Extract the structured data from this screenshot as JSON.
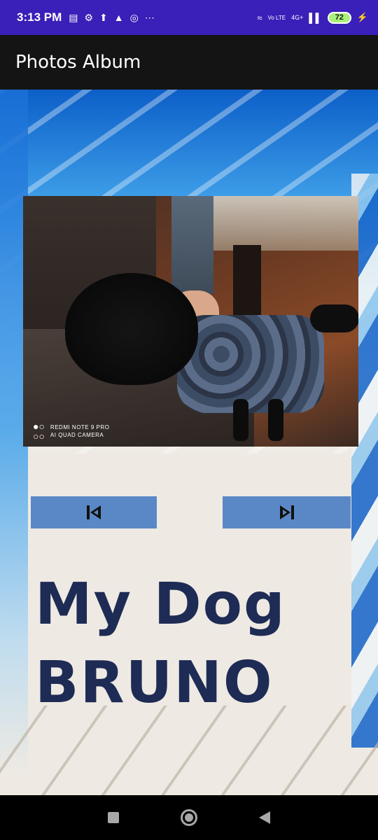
{
  "status_bar": {
    "time": "3:13 PM",
    "left_icons": [
      "message-icon",
      "settings-icon",
      "upload-icon",
      "gallery-icon",
      "vpn-icon",
      "more-icon"
    ],
    "network_label": "4G+",
    "volte_label": "Vo LTE",
    "battery_level": "72",
    "charging": true
  },
  "app_bar": {
    "title": "Photos Album"
  },
  "photo": {
    "watermark_line1": "REDMI NOTE 9 PRO",
    "watermark_line2": "AI QUAD CAMERA"
  },
  "controls": {
    "prev_icon": "skip-previous-icon",
    "next_icon": "skip-next-icon"
  },
  "caption": {
    "line1": "My Dog",
    "line2": "BRUNO",
    "color": "#1e2b55"
  },
  "colors": {
    "status_bar": "#3a1fb8",
    "app_bar": "#141414",
    "button": "#5a88c6"
  }
}
